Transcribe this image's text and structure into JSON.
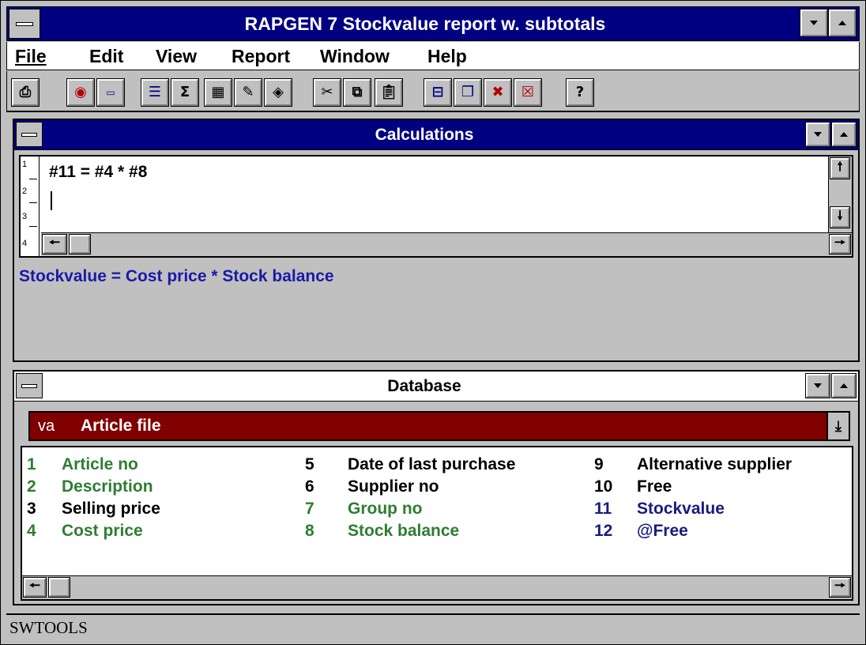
{
  "app": {
    "title": "RAPGEN 7 Stockvalue report w. subtotals"
  },
  "menu": {
    "items": [
      {
        "label": "File"
      },
      {
        "label": "Edit"
      },
      {
        "label": "View"
      },
      {
        "label": "Report"
      },
      {
        "label": "Window"
      },
      {
        "label": "Help"
      }
    ]
  },
  "toolbar": {
    "help_glyph": "?"
  },
  "calculations": {
    "title": "Calculations",
    "line_numbers": [
      "1",
      "2",
      "3",
      "4"
    ],
    "code_lines": [
      "#11 = #4 * #8"
    ],
    "description": "Stockvalue = Cost price * Stock balance"
  },
  "database": {
    "title": "Database",
    "file_code": "va",
    "file_name": "Article file",
    "fields": [
      {
        "num": "1",
        "label": "Article no",
        "color": "#2e7d32"
      },
      {
        "num": "2",
        "label": "Description",
        "color": "#2e7d32"
      },
      {
        "num": "3",
        "label": "Selling price",
        "color": "#000000"
      },
      {
        "num": "4",
        "label": "Cost price",
        "color": "#2e7d32"
      },
      {
        "num": "5",
        "label": "Date of last purchase",
        "color": "#000000"
      },
      {
        "num": "6",
        "label": "Supplier no",
        "color": "#000000"
      },
      {
        "num": "7",
        "label": "Group no",
        "color": "#2e7d32"
      },
      {
        "num": "8",
        "label": "Stock balance",
        "color": "#2e7d32"
      },
      {
        "num": "9",
        "label": "Alternative supplier",
        "color": "#000000"
      },
      {
        "num": "10",
        "label": "Free",
        "color": "#000000"
      },
      {
        "num": "11",
        "label": "Stockvalue",
        "color": "#1a1a80"
      },
      {
        "num": "12",
        "label": "@Free",
        "color": "#1a1a80"
      }
    ]
  },
  "status": {
    "text": "SWTOOLS"
  },
  "colors": {
    "title_bar": "#000080",
    "db_file_bar": "#800000",
    "window_bg": "#c0c0c0",
    "description_blue": "#1a1aa8"
  }
}
